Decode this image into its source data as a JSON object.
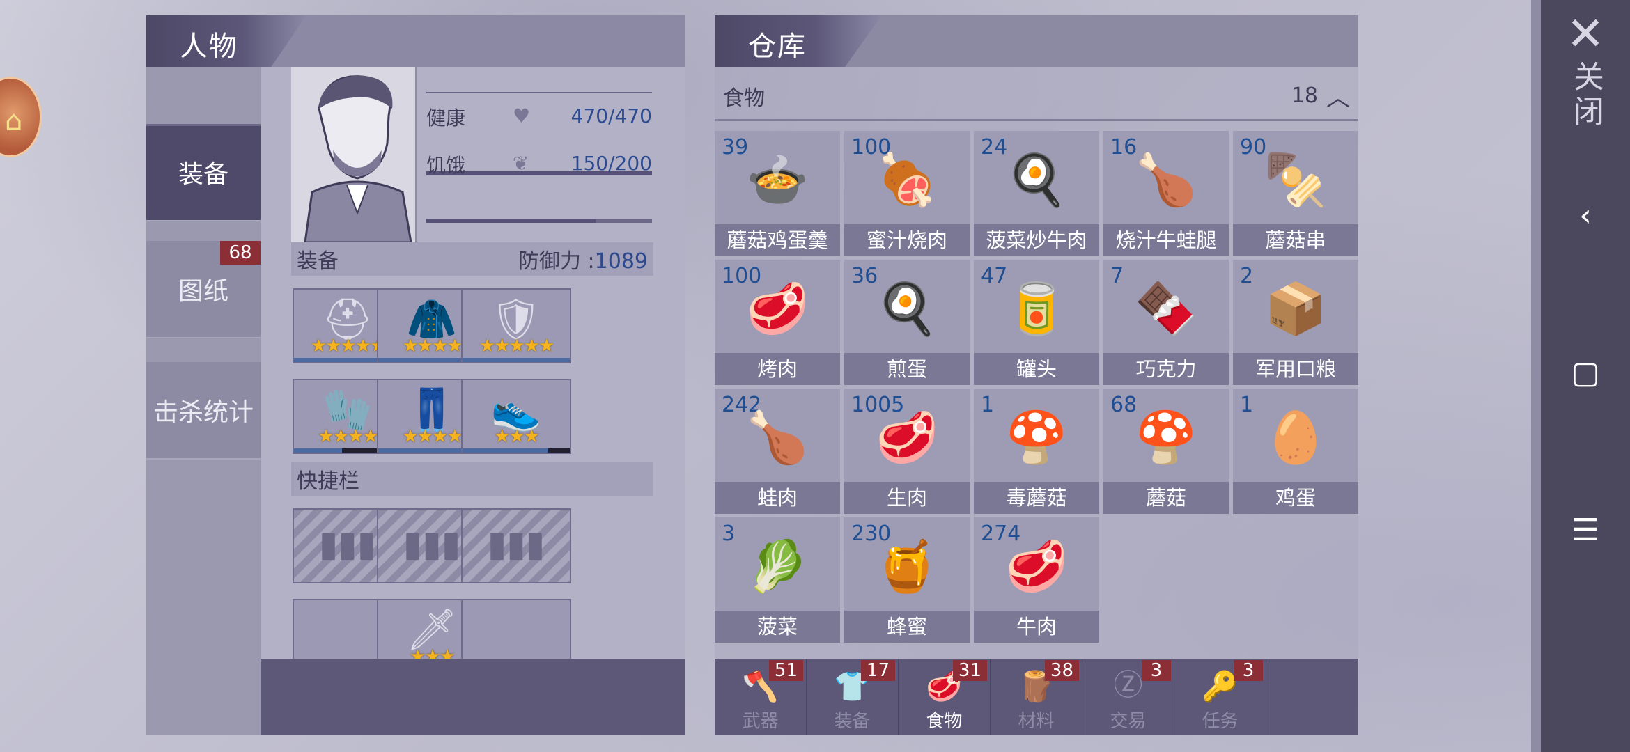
{
  "character": {
    "title": "人物",
    "tabs": [
      {
        "label": "装备",
        "badge": ""
      },
      {
        "label": "图纸",
        "badge": "68"
      },
      {
        "label": "击杀统计",
        "badge": ""
      }
    ],
    "stats": {
      "health_label": "健康",
      "health_value": "470/470",
      "health_fraction": 1.0,
      "hunger_label": "饥饿",
      "hunger_value": "150/200",
      "hunger_fraction": 0.75
    },
    "equipment": {
      "label": "装备",
      "defense_label": "防御力 :",
      "defense_value": "1089",
      "slots": [
        {
          "icon": "helmet-icon",
          "glyph": "⛑",
          "stars": "★★★★★",
          "durability": 1.0
        },
        {
          "icon": "armor-icon",
          "glyph": "🧥",
          "stars": "★★★★",
          "durability": 0.8
        },
        {
          "icon": "shell-icon",
          "glyph": "🛡",
          "stars": "★★★★★",
          "durability": 1.0
        },
        {
          "icon": "gloves-icon",
          "glyph": "🧤",
          "stars": "★★★★",
          "durability": 0.45
        },
        {
          "icon": "pants-icon",
          "glyph": "👖",
          "stars": "★★★★",
          "durability": 0.8
        },
        {
          "icon": "shoes-icon",
          "glyph": "👟",
          "stars": "★★★",
          "durability": 0.8
        }
      ]
    },
    "quickbar": {
      "label": "快捷栏",
      "slots": [
        {
          "icon": "ammo-icon",
          "glyph": "▮▮▮",
          "stars": "",
          "hatched": true
        },
        {
          "icon": "ammo-icon",
          "glyph": "▮▮▮",
          "stars": "",
          "hatched": true
        },
        {
          "icon": "ammo-icon",
          "glyph": "▮▮▮",
          "stars": "",
          "hatched": true
        },
        {
          "icon": "empty-slot",
          "glyph": "",
          "stars": "",
          "hatched": false
        },
        {
          "icon": "knife-icon",
          "glyph": "🗡",
          "stars": "★★★",
          "hatched": false,
          "durability": 1.0
        },
        {
          "icon": "empty-slot",
          "glyph": "",
          "stars": "",
          "hatched": false
        }
      ]
    }
  },
  "warehouse": {
    "title": "仓库",
    "category": {
      "label": "食物",
      "count": "18"
    },
    "items": [
      {
        "qty": "39",
        "name": "蘑菇鸡蛋羹",
        "icon": "bowl-icon",
        "glyph": "🍲"
      },
      {
        "qty": "100",
        "name": "蜜汁烧肉",
        "icon": "meat-icon",
        "glyph": "🍖"
      },
      {
        "qty": "24",
        "name": "菠菜炒牛肉",
        "icon": "pan-icon",
        "glyph": "🍳"
      },
      {
        "qty": "16",
        "name": "烧汁牛蛙腿",
        "icon": "legs-icon",
        "glyph": "🍗"
      },
      {
        "qty": "90",
        "name": "蘑菇串",
        "icon": "skewer-icon",
        "glyph": "🍢"
      },
      {
        "qty": "100",
        "name": "烤肉",
        "icon": "steak-icon",
        "glyph": "🥩"
      },
      {
        "qty": "36",
        "name": "煎蛋",
        "icon": "egg-fried-icon",
        "glyph": "🍳"
      },
      {
        "qty": "47",
        "name": "罐头",
        "icon": "can-icon",
        "glyph": "🥫"
      },
      {
        "qty": "7",
        "name": "巧克力",
        "icon": "chocolate-icon",
        "glyph": "🍫"
      },
      {
        "qty": "2",
        "name": "军用口粮",
        "icon": "ration-icon",
        "glyph": "📦"
      },
      {
        "qty": "242",
        "name": "蛙肉",
        "icon": "frog-meat-icon",
        "glyph": "🍗"
      },
      {
        "qty": "1005",
        "name": "生肉",
        "icon": "raw-meat-icon",
        "glyph": "🥩"
      },
      {
        "qty": "1",
        "name": "毒蘑菇",
        "icon": "poison-mushroom-icon",
        "glyph": "🍄"
      },
      {
        "qty": "68",
        "name": "蘑菇",
        "icon": "mushroom-icon",
        "glyph": "🍄"
      },
      {
        "qty": "1",
        "name": "鸡蛋",
        "icon": "eggs-icon",
        "glyph": "🥚"
      },
      {
        "qty": "3",
        "name": "菠菜",
        "icon": "spinach-icon",
        "glyph": "🥬"
      },
      {
        "qty": "230",
        "name": "蜂蜜",
        "icon": "honey-icon",
        "glyph": "🍯"
      },
      {
        "qty": "274",
        "name": "牛肉",
        "icon": "beef-icon",
        "glyph": "🥩"
      }
    ],
    "bottom_tabs": [
      {
        "label": "武器",
        "badge": "51",
        "icon": "axe-icon",
        "glyph": "🪓",
        "active": false
      },
      {
        "label": "装备",
        "badge": "17",
        "icon": "shirt-icon",
        "glyph": "👕",
        "active": false
      },
      {
        "label": "食物",
        "badge": "31",
        "icon": "food-icon",
        "glyph": "🥩",
        "active": true
      },
      {
        "label": "材料",
        "badge": "38",
        "icon": "material-icon",
        "glyph": "🪵",
        "active": false
      },
      {
        "label": "交易",
        "badge": "3",
        "icon": "coin-icon",
        "glyph": "Ⓩ",
        "active": false
      },
      {
        "label": "任务",
        "badge": "3",
        "icon": "key-icon",
        "glyph": "🔑",
        "active": false
      }
    ]
  },
  "nav": {
    "close_label": "关闭",
    "close_glyph": "✕",
    "back_glyph": "‹",
    "home_glyph": "▢",
    "menu_glyph": "☰"
  },
  "colors": {
    "accent": "#4f4a6a",
    "badge": "#8b2e35",
    "qty": "#1f4f92",
    "star": "#f3b21e"
  }
}
